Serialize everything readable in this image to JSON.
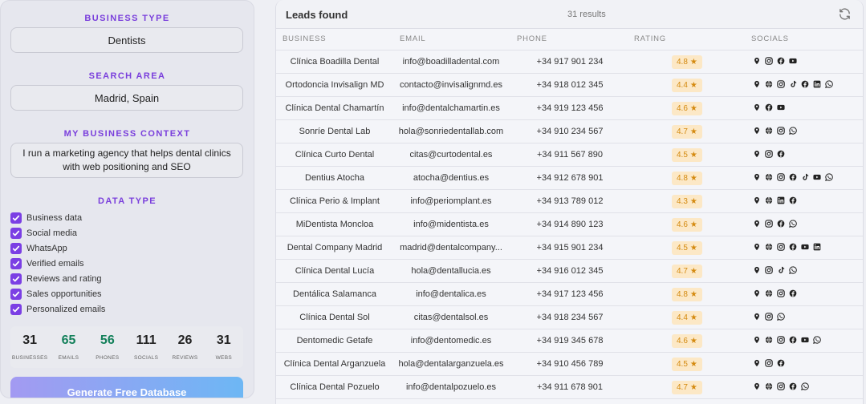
{
  "left": {
    "business_type_label": "BUSINESS TYPE",
    "business_type_value": "Dentists",
    "search_area_label": "SEARCH AREA",
    "search_area_value": "Madrid, Spain",
    "context_label": "MY BUSINESS CONTEXT",
    "context_value": "I run a marketing agency that helps dental clinics with web positioning and SEO",
    "data_type_label": "DATA TYPE",
    "data_types": [
      "Business data",
      "Social media",
      "WhatsApp",
      "Verified emails",
      "Reviews and rating",
      "Sales opportunities",
      "Personalized emails"
    ],
    "stats": [
      {
        "value": "31",
        "label": "BUSINESSES",
        "color": "#222222"
      },
      {
        "value": "65",
        "label": "EMAILS",
        "color": "#13805a"
      },
      {
        "value": "56",
        "label": "PHONES",
        "color": "#13805a"
      },
      {
        "value": "111",
        "label": "SOCIALS",
        "color": "#222222"
      },
      {
        "value": "26",
        "label": "REVIEWS",
        "color": "#222222"
      },
      {
        "value": "31",
        "label": "WEBS",
        "color": "#222222"
      }
    ],
    "generate_label": "Generate Free Database"
  },
  "results": {
    "title": "Leads found",
    "count": "31 results",
    "columns": [
      "BUSINESS",
      "EMAIL",
      "PHONE",
      "RATING",
      "SOCIALS"
    ],
    "rows": [
      {
        "business": "Clínica Boadilla Dental",
        "email": "info@boadilladental.com",
        "phone": "+34 917 901 234",
        "rating": "4.8",
        "socials": [
          "pin",
          "instagram",
          "facebook",
          "youtube"
        ]
      },
      {
        "business": "Ortodoncia Invisalign MD",
        "email": "contacto@invisalignmd.es",
        "phone": "+34 918 012 345",
        "rating": "4.4",
        "socials": [
          "pin",
          "web",
          "instagram",
          "tiktok",
          "facebook",
          "linkedin",
          "whatsapp"
        ]
      },
      {
        "business": "Clínica Dental Chamartín",
        "email": "info@dentalchamartin.es",
        "phone": "+34 919 123 456",
        "rating": "4.6",
        "socials": [
          "pin",
          "facebook",
          "youtube"
        ]
      },
      {
        "business": "Sonríe Dental Lab",
        "email": "hola@sonriedentallab.com",
        "phone": "+34 910 234 567",
        "rating": "4.7",
        "socials": [
          "pin",
          "web",
          "instagram",
          "whatsapp"
        ]
      },
      {
        "business": "Clínica Curto Dental",
        "email": "citas@curtodental.es",
        "phone": "+34 911 567 890",
        "rating": "4.5",
        "socials": [
          "pin",
          "instagram",
          "facebook"
        ]
      },
      {
        "business": "Dentius Atocha",
        "email": "atocha@dentius.es",
        "phone": "+34 912 678 901",
        "rating": "4.8",
        "socials": [
          "pin",
          "web",
          "instagram",
          "facebook",
          "tiktok",
          "youtube",
          "whatsapp"
        ]
      },
      {
        "business": "Clínica Perio & Implant",
        "email": "info@periomplant.es",
        "phone": "+34 913 789 012",
        "rating": "4.3",
        "socials": [
          "pin",
          "web",
          "linkedin",
          "facebook"
        ]
      },
      {
        "business": "MiDentista Moncloa",
        "email": "info@midentista.es",
        "phone": "+34 914 890 123",
        "rating": "4.6",
        "socials": [
          "pin",
          "instagram",
          "facebook",
          "whatsapp"
        ]
      },
      {
        "business": "Dental Company Madrid",
        "email": "madrid@dentalcompany...",
        "phone": "+34 915 901 234",
        "rating": "4.5",
        "socials": [
          "pin",
          "web",
          "instagram",
          "facebook",
          "youtube",
          "linkedin"
        ]
      },
      {
        "business": "Clínica Dental Lucía",
        "email": "hola@dentallucia.es",
        "phone": "+34 916 012 345",
        "rating": "4.7",
        "socials": [
          "pin",
          "instagram",
          "tiktok",
          "whatsapp"
        ]
      },
      {
        "business": "Dentálica Salamanca",
        "email": "info@dentalica.es",
        "phone": "+34 917 123 456",
        "rating": "4.8",
        "socials": [
          "pin",
          "web",
          "instagram",
          "facebook"
        ]
      },
      {
        "business": "Clínica Dental Sol",
        "email": "citas@dentalsol.es",
        "phone": "+34 918 234 567",
        "rating": "4.4",
        "socials": [
          "pin",
          "instagram",
          "whatsapp"
        ]
      },
      {
        "business": "Dentomedic Getafe",
        "email": "info@dentomedic.es",
        "phone": "+34 919 345 678",
        "rating": "4.6",
        "socials": [
          "pin",
          "web",
          "instagram",
          "facebook",
          "youtube",
          "whatsapp"
        ]
      },
      {
        "business": "Clínica Dental Arganzuela",
        "email": "hola@dentalarganzuela.es",
        "phone": "+34 910 456 789",
        "rating": "4.5",
        "socials": [
          "pin",
          "instagram",
          "facebook"
        ]
      },
      {
        "business": "Clínica Dental Pozuelo",
        "email": "info@dentalpozuelo.es",
        "phone": "+34 911 678 901",
        "rating": "4.7",
        "socials": [
          "pin",
          "web",
          "instagram",
          "facebook",
          "whatsapp"
        ]
      }
    ]
  },
  "colors": {
    "accent": "#7b3fe4",
    "rating_bg": "#fce8c6",
    "rating_text": "#d48a10",
    "stat_green": "#13805a"
  }
}
